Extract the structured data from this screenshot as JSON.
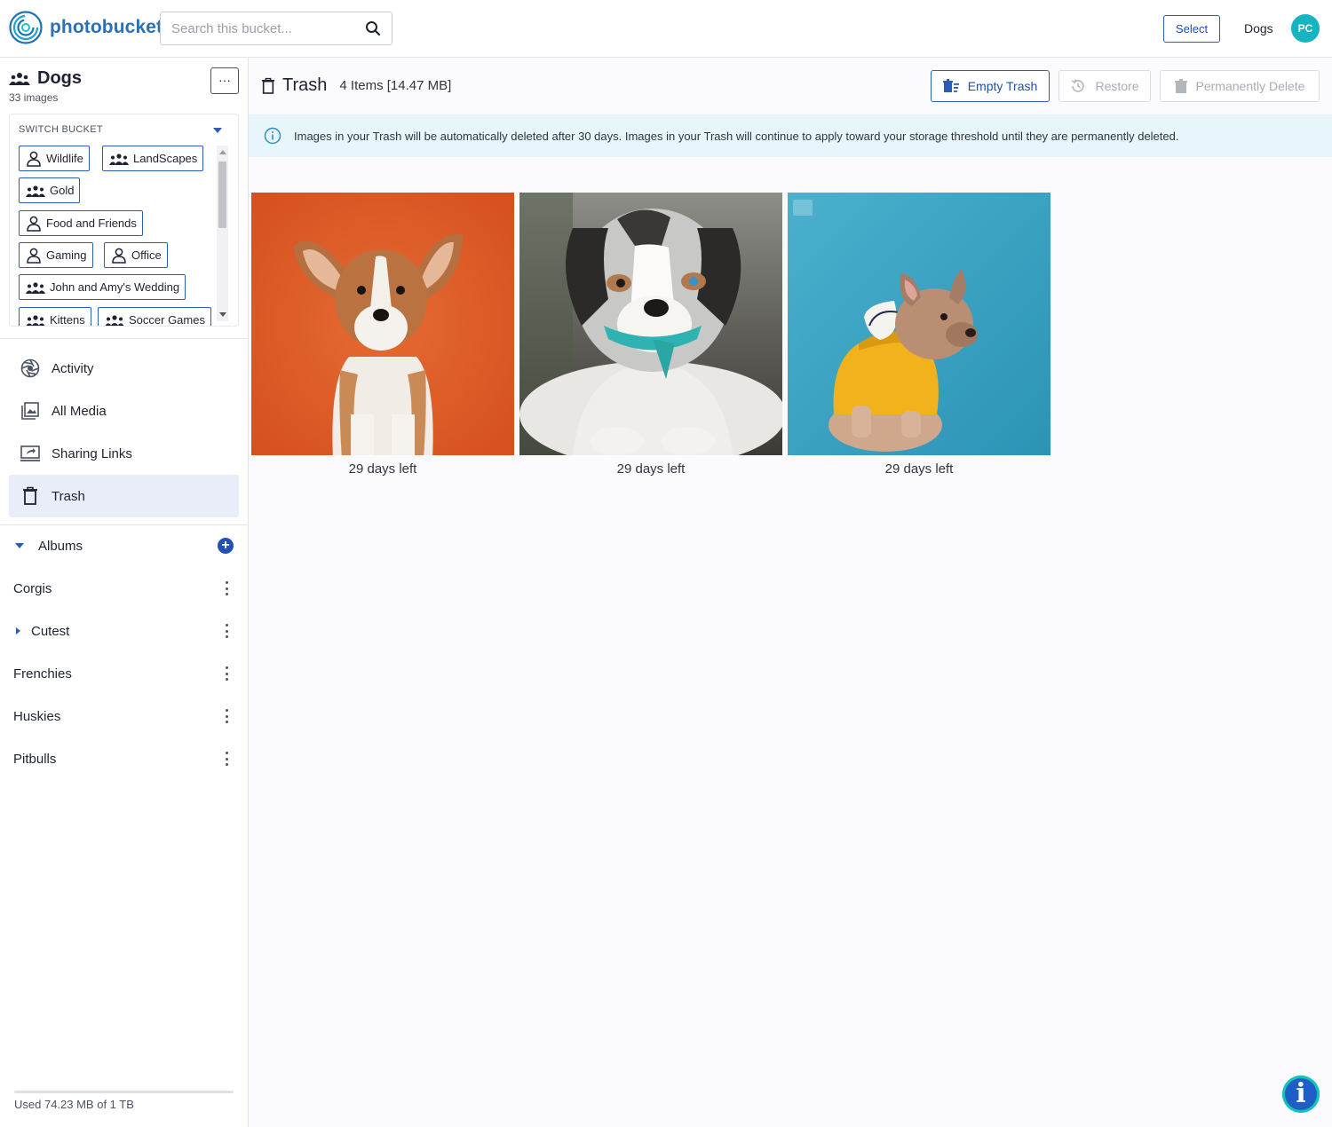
{
  "app": {
    "brand": "photobucket"
  },
  "header": {
    "search_placeholder": "Search this bucket...",
    "select_label": "Select",
    "current_bucket": "Dogs",
    "avatar_initials": "PC"
  },
  "sidebar": {
    "bucket_title": "Dogs",
    "bucket_count": "33 images",
    "more_label": "···",
    "switch_label": "SWITCH BUCKET",
    "buckets": [
      {
        "label": "Wildlife",
        "icon": "person-icon"
      },
      {
        "label": "LandScapes",
        "icon": "group-icon"
      },
      {
        "label": "Gold",
        "icon": "group-icon"
      },
      {
        "label": "Food and Friends",
        "icon": "person-icon"
      },
      {
        "label": "Gaming",
        "icon": "person-icon"
      },
      {
        "label": "Office",
        "icon": "person-icon"
      },
      {
        "label": "John and Amy's Wedding",
        "icon": "group-icon"
      },
      {
        "label": "Kittens",
        "icon": "group-icon"
      },
      {
        "label": "Soccer Games",
        "icon": "group-icon"
      }
    ],
    "nav": [
      {
        "label": "Activity",
        "icon": "aperture-icon"
      },
      {
        "label": "All Media",
        "icon": "gallery-icon"
      },
      {
        "label": "Sharing Links",
        "icon": "share-screen-icon"
      },
      {
        "label": "Trash",
        "icon": "trash-icon",
        "active": true
      }
    ],
    "albums_label": "Albums",
    "albums": [
      {
        "label": "Corgis",
        "has_children": false
      },
      {
        "label": "Cutest",
        "has_children": true
      },
      {
        "label": "Frenchies",
        "has_children": false
      },
      {
        "label": "Huskies",
        "has_children": false
      },
      {
        "label": "Pitbulls",
        "has_children": false
      }
    ],
    "usage_text": "Used 74.23 MB of 1 TB",
    "usage_fraction": 0.0001
  },
  "main": {
    "title": "Trash",
    "subtitle": "4 Items [14.47 MB]",
    "actions": {
      "empty_trash": "Empty Trash",
      "restore": "Restore",
      "permanently_delete": "Permanently Delete"
    },
    "notice": "Images in your Trash will be automatically deleted after 30 days. Images in your Trash will continue to apply toward your storage threshold until they are permanently deleted.",
    "items": [
      {
        "caption": "29 days left",
        "subject": "corgi puppy on orange background",
        "bg": "#e0602c"
      },
      {
        "caption": "29 days left",
        "subject": "australian shepherd puppy lying on ground",
        "bg": "#6f6e6a"
      },
      {
        "caption": "29 days left",
        "subject": "french bulldog in yellow hoodie on blue background",
        "bg": "#3aa3c4"
      }
    ]
  },
  "colors": {
    "accent": "#2c5bb8",
    "active_nav": "#e9edf9",
    "notice_bg": "#e8f6fb",
    "avatar": "#16b3c1"
  }
}
